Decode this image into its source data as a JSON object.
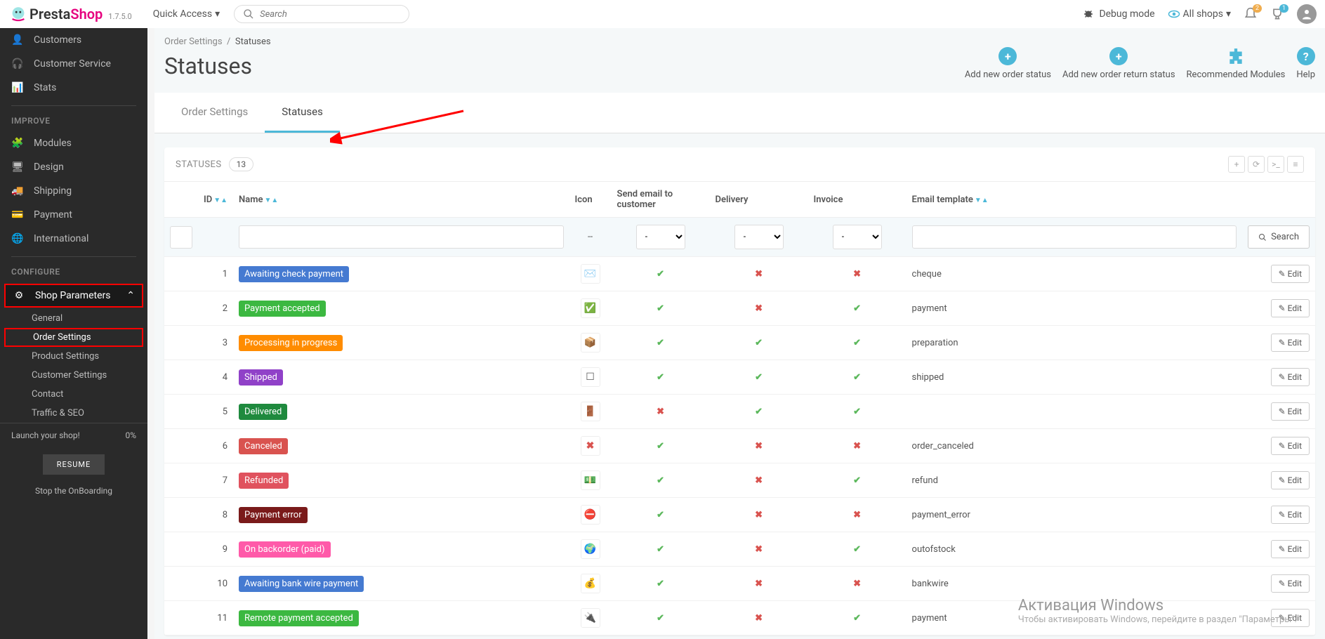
{
  "brand": {
    "presta": "Presta",
    "shop": "Shop",
    "version": "1.7.5.0"
  },
  "topbar": {
    "quick_access": "Quick Access",
    "search_placeholder": "Search",
    "debug": "Debug mode",
    "all_shops": "All shops",
    "notif_count": "2",
    "cart_count": "1"
  },
  "sidebar": {
    "customers": "Customers",
    "customer_service": "Customer Service",
    "stats": "Stats",
    "improve": "IMPROVE",
    "modules": "Modules",
    "design": "Design",
    "shipping": "Shipping",
    "payment": "Payment",
    "international": "International",
    "configure": "CONFIGURE",
    "shop_params": "Shop Parameters",
    "sub": {
      "general": "General",
      "order_settings": "Order Settings",
      "product_settings": "Product Settings",
      "customer_settings": "Customer Settings",
      "contact": "Contact",
      "traffic": "Traffic & SEO"
    },
    "launch": "Launch your shop!",
    "launch_pct": "0%",
    "resume": "RESUME",
    "stop": "Stop the OnBoarding"
  },
  "breadcrumb": {
    "a": "Order Settings",
    "sep": "/",
    "b": "Statuses"
  },
  "page": {
    "title": "Statuses"
  },
  "actions": {
    "add_status": "Add new order status",
    "add_return": "Add new order return status",
    "modules": "Recommended Modules",
    "help": "Help"
  },
  "tabs": {
    "order_settings": "Order Settings",
    "statuses": "Statuses"
  },
  "panel": {
    "title": "STATUSES",
    "count": "13",
    "search": "Search"
  },
  "columns": {
    "id": "ID",
    "name": "Name",
    "icon": "Icon",
    "send_email": "Send email to customer",
    "delivery": "Delivery",
    "invoice": "Invoice",
    "email_template": "Email template"
  },
  "filters": {
    "icon": "--",
    "dash": "-"
  },
  "edit_label": "Edit",
  "rows": [
    {
      "id": "1",
      "name": "Awaiting check payment",
      "color": "#457ad1",
      "icon": "✉️",
      "email": true,
      "delivery": false,
      "invoice": false,
      "template": "cheque"
    },
    {
      "id": "2",
      "name": "Payment accepted",
      "color": "#3cb841",
      "icon": "✅",
      "icon_color": "#3cb841",
      "email": true,
      "delivery": false,
      "invoice": true,
      "template": "payment"
    },
    {
      "id": "3",
      "name": "Processing in progress",
      "color": "#ff8c00",
      "icon": "📦",
      "email": true,
      "delivery": true,
      "invoice": true,
      "template": "preparation"
    },
    {
      "id": "4",
      "name": "Shipped",
      "color": "#9041c8",
      "icon": "☐",
      "email": true,
      "delivery": true,
      "invoice": true,
      "template": "shipped"
    },
    {
      "id": "5",
      "name": "Delivered",
      "color": "#1f8a3e",
      "icon": "🚪",
      "email": false,
      "delivery": true,
      "invoice": true,
      "template": ""
    },
    {
      "id": "6",
      "name": "Canceled",
      "color": "#d9534f",
      "icon": "✖",
      "icon_color": "#d9534f",
      "email": true,
      "delivery": false,
      "invoice": false,
      "template": "order_canceled"
    },
    {
      "id": "7",
      "name": "Refunded",
      "color": "#e0525e",
      "icon": "💵",
      "email": true,
      "delivery": false,
      "invoice": true,
      "template": "refund"
    },
    {
      "id": "8",
      "name": "Payment error",
      "color": "#7a1a1a",
      "icon": "⛔",
      "icon_color": "#d9534f",
      "email": true,
      "delivery": false,
      "invoice": false,
      "template": "payment_error"
    },
    {
      "id": "9",
      "name": "On backorder (paid)",
      "color": "#ff5aa9",
      "icon": "🌍",
      "email": true,
      "delivery": false,
      "invoice": true,
      "template": "outofstock"
    },
    {
      "id": "10",
      "name": "Awaiting bank wire payment",
      "color": "#457ad1",
      "icon": "💰",
      "email": true,
      "delivery": false,
      "invoice": false,
      "template": "bankwire"
    },
    {
      "id": "11",
      "name": "Remote payment accepted",
      "color": "#3cb841",
      "icon": "🔌",
      "email": true,
      "delivery": false,
      "invoice": true,
      "template": "payment"
    }
  ],
  "watermark": {
    "title": "Активация Windows",
    "line": "Чтобы активировать Windows, перейдите в раздел \"Параметры\"."
  }
}
